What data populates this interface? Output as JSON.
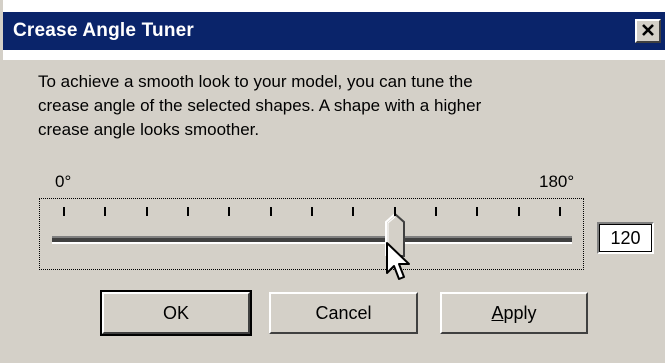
{
  "window": {
    "title": "Crease Angle Tuner",
    "close_glyph": "x",
    "close_icon": "close-icon"
  },
  "description": {
    "lines": [
      "To achieve a smooth look to your model, you can tune the",
      "crease angle of the selected shapes. A shape with a higher",
      "crease angle looks smoother."
    ]
  },
  "slider": {
    "min_label": "0°",
    "max_label": "180°",
    "min": 0,
    "max": 180,
    "value": 120,
    "tick_count": 13
  },
  "value_box": {
    "value": "120"
  },
  "buttons": {
    "ok": "OK",
    "cancel": "Cancel",
    "apply_underlined": "A",
    "apply_rest": "pply"
  },
  "colors": {
    "titlebar": "#0a246a",
    "face": "#d4d0c8"
  }
}
